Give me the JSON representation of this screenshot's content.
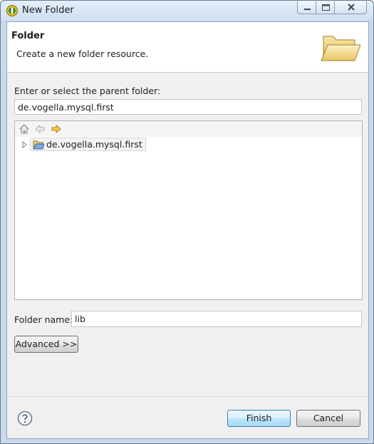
{
  "window": {
    "title": "New Folder"
  },
  "banner": {
    "title": "Folder",
    "message": "Create a new folder resource."
  },
  "parent": {
    "label": "Enter or select the parent folder:",
    "value": "de.vogella.mysql.first"
  },
  "tree": {
    "items": [
      {
        "label": "de.vogella.mysql.first",
        "icon": "open-project-folder-icon",
        "expanded": false
      }
    ],
    "toolbar": [
      "home-icon",
      "back-arrow-icon",
      "forward-arrow-icon"
    ]
  },
  "folder_name": {
    "label": "Folder name:",
    "value": "lib"
  },
  "buttons": {
    "advanced": "Advanced >>",
    "finish": "Finish",
    "cancel": "Cancel"
  },
  "colors": {
    "title_bar": "#cfdff2",
    "dialog_bg": "#f0f0f0",
    "default_button_border": "#3c7fb1"
  }
}
